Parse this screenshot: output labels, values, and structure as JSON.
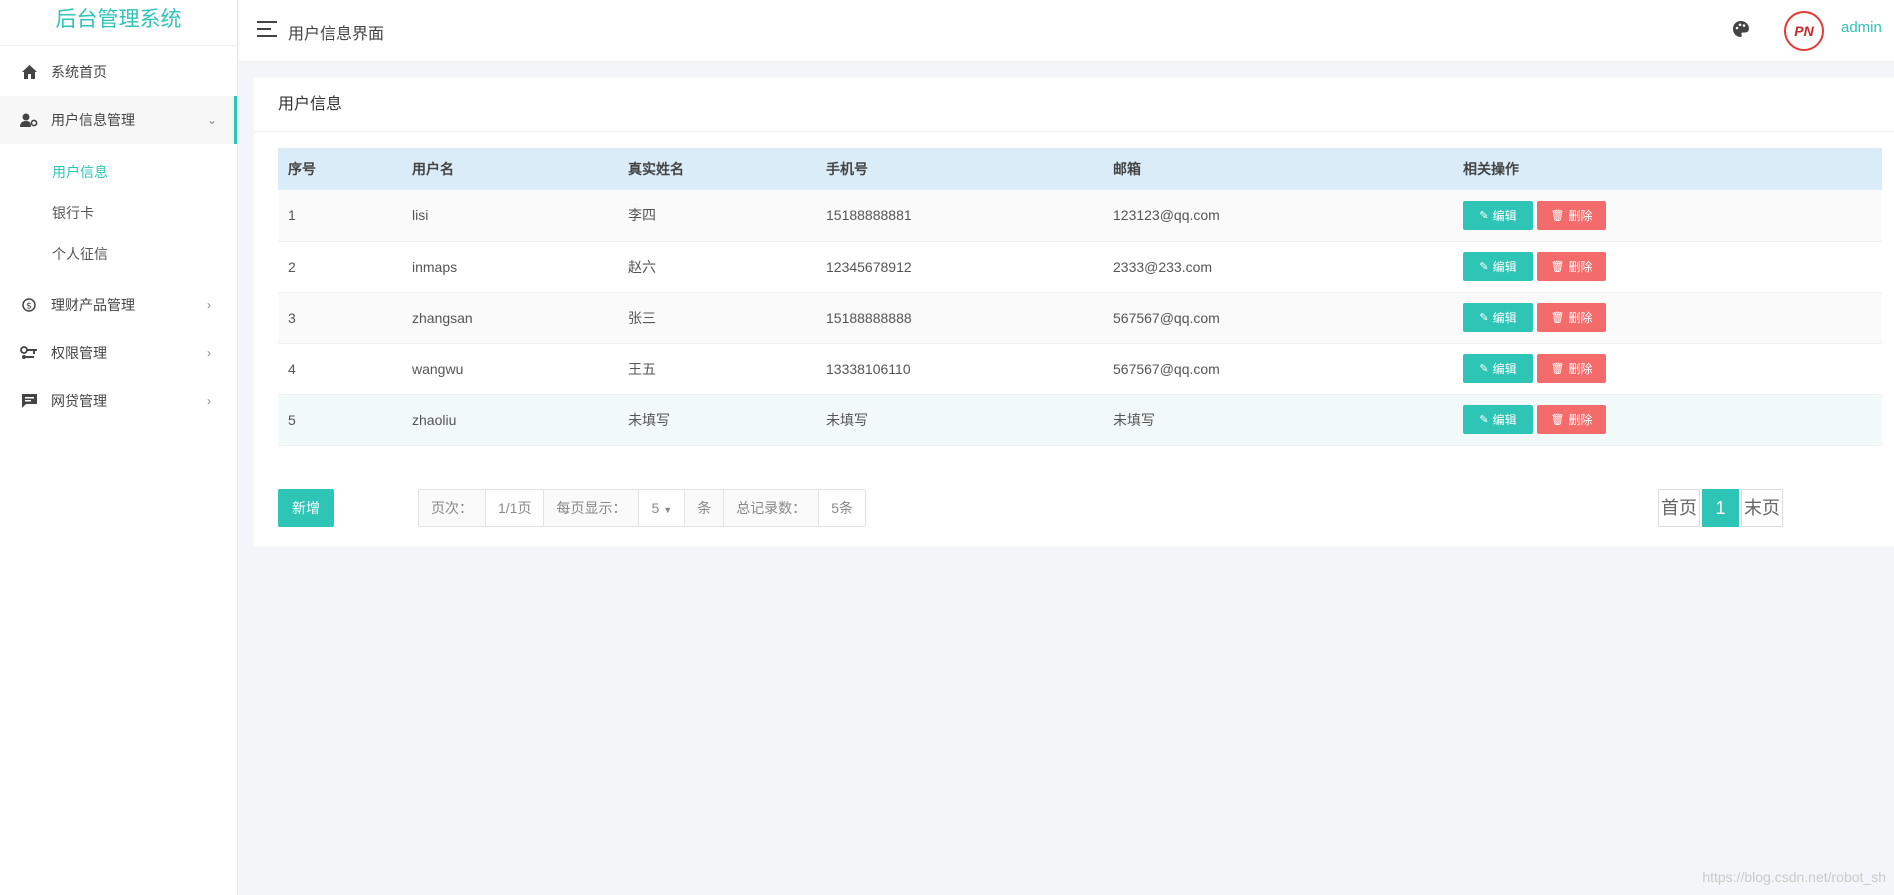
{
  "sidebar": {
    "brand": "后台管理系统",
    "items": [
      {
        "label": "系统首页",
        "icon": "home-icon"
      },
      {
        "label": "用户信息管理",
        "icon": "user-gear-icon",
        "arrow": "⌄"
      },
      {
        "label": "理财产品管理",
        "icon": "coin-icon",
        "arrow": "›"
      },
      {
        "label": "权限管理",
        "icon": "key-icon",
        "arrow": "›"
      },
      {
        "label": "网贷管理",
        "icon": "message-icon",
        "arrow": "›"
      }
    ],
    "sub_items": [
      "用户信息",
      "银行卡",
      "个人征信"
    ]
  },
  "header": {
    "title": "用户信息界面",
    "avatar_text": "PN",
    "username": "admin"
  },
  "panel": {
    "title": "用户信息"
  },
  "table": {
    "columns": [
      "序号",
      "用户名",
      "真实姓名",
      "手机号",
      "邮箱",
      "相关操作"
    ],
    "rows": [
      [
        "1",
        "lisi",
        "李四",
        "15188888881",
        "123123@qq.com"
      ],
      [
        "2",
        "inmaps",
        "赵六",
        "12345678912",
        "2333@233.com"
      ],
      [
        "3",
        "zhangsan",
        "张三",
        "15188888888",
        "567567@qq.com"
      ],
      [
        "4",
        "wangwu",
        "王五",
        "13338106110",
        "567567@qq.com"
      ],
      [
        "5",
        "zhaoliu",
        "未填写",
        "未填写",
        "未填写"
      ]
    ],
    "edit_label": "编辑",
    "delete_label": "删除"
  },
  "footer": {
    "add_label": "新增",
    "page_label": "页次：",
    "page_value": "1/1页",
    "per_page_label": "每页显示：",
    "per_page_value": "5",
    "unit": "条",
    "total_label": "总记录数：",
    "total_value": "5条",
    "first_label": "首页",
    "current_page": "1",
    "last_label": "末页"
  },
  "watermark": "https://blog.csdn.net/robot_sh",
  "colors": {
    "accent": "#2ec4b6",
    "danger": "#f46b6b",
    "table_header": "#d9ecf8"
  }
}
